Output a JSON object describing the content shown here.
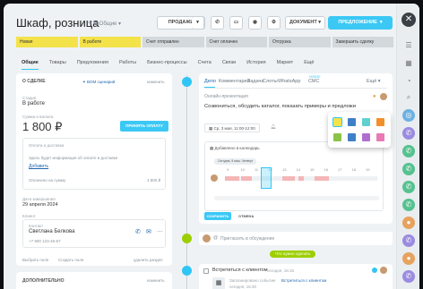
{
  "header": {
    "title": "Шкаф, розница",
    "subtitle": "Общие",
    "btn_sales": "ПРОДАЖИ",
    "btn_document": "ДОКУМЕНТ",
    "btn_offer": "ПРЕДЛОЖЕНИЕ"
  },
  "stages": [
    {
      "label": "Новая",
      "color": "#f4e24a"
    },
    {
      "label": "В работе",
      "color": "#f4e24a"
    },
    {
      "label": "Счет отправлен",
      "color": "#d3d8dc"
    },
    {
      "label": "Счет оплачен",
      "color": "#d3d8dc"
    },
    {
      "label": "Отгрузка",
      "color": "#d3d8dc"
    },
    {
      "label": "Завершить сделку",
      "color": "#d3d8dc"
    }
  ],
  "tabs": [
    "Общие",
    "Товары",
    "Предложения",
    "Работы",
    "Бизнес-процессы",
    "Счета",
    "Связи",
    "История",
    "Маркет",
    "Ещё"
  ],
  "deal": {
    "section": "О СДЕЛКЕ",
    "copilot": "Copilot",
    "scenario": "BOM сценарий",
    "edit": "изменить",
    "status_label": "Стадия",
    "status_value": "В работе",
    "amount_label": "Сумма и валюта",
    "amount_value": "1 800 ₽",
    "pay_btn": "ПРИНЯТЬ ОПЛАТУ",
    "payment_label": "Оплата и доставка",
    "payment_hint": "Здесь будет информация об оплате и доставке",
    "add_link": "Добавить",
    "paid_text": "Оплачено на сумму",
    "paid_value": "1 800 ₽",
    "date_label": "Дата завершения",
    "date_value": "29 апреля 2024",
    "client_label": "Клиент",
    "contact_label": "Контакт",
    "contact_name": "Светлана Белкова",
    "contact_phone": "+7 900 123-45-67",
    "choose_field": "Выбрать поле",
    "create_field": "Создать поле",
    "delete_section": "удалить раздел",
    "extra_section": "ДОПОЛНИТЕЛЬНО",
    "extra_edit": "изменить"
  },
  "activity": {
    "tabs": [
      "Дело",
      "Комментарий",
      "Задача",
      "Слоты",
      "WhatsApp",
      "СМС"
    ],
    "new_badge": "НОВОЕ",
    "more": "Ещё",
    "type": "Онлайн-презентация",
    "text": "Созвониться, обсудить каталог, показать примеры и предложи",
    "date_chip": "Ср, 3 мая, 11:00-12:00",
    "calendar_added": "Добавлено в календарь",
    "today_label": "Сегодня, 5 мая, Четверг",
    "hours": [
      "9",
      "10",
      "11",
      "12",
      "13",
      "14",
      "15",
      "16",
      "17",
      "18",
      "19"
    ],
    "save_btn": "СОХРАНИТЬ",
    "cancel_btn": "ОТМЕНА"
  },
  "comment_placeholder": "Пригласить в обсуждение",
  "plan_badge": "Что нужно сделать",
  "meeting": {
    "title": "Встретиться с клиентом",
    "meta": "сегодня, 16:15",
    "status": "Запланировано событие",
    "subtitle": "Встретиться с клиентом",
    "time": "сегодня, 16:30"
  },
  "colors": {
    "accent": "#2fc6f6",
    "link": "#2067b0",
    "stage_active": "#f4e24a",
    "stage_inactive": "#d3d8dc",
    "green": "#9dcf00",
    "pay": "#3bc8f5"
  },
  "swatches": [
    "#f4e24a",
    "#3f7fc7",
    "#5fd0d0",
    "#f28f2c",
    "#8bc34a",
    "#3f7fc7",
    "#b06fd0",
    "#e879b5"
  ]
}
